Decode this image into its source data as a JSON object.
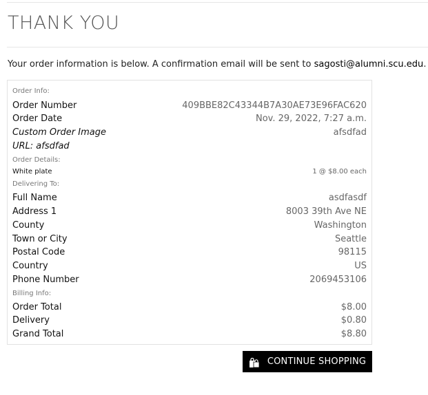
{
  "page": {
    "title": "THANK YOU",
    "intro_text": "Your order information is below. A confirmation email will be sent to",
    "email": "sagosti@alumni.scu.edu",
    "intro_end": "."
  },
  "order_info": {
    "section_label": "Order Info:",
    "order_number_label": "Order Number",
    "order_number_value": "409BBE82C43344B7A30AE73E96FAC620",
    "order_date_label": "Order Date",
    "order_date_value": "Nov. 29, 2022, 7:27 a.m.",
    "custom_image_label": "Custom Order Image",
    "custom_image_value": "afsdfad",
    "url_label": "URL: afsdfad"
  },
  "order_details": {
    "section_label": "Order Details:",
    "item_label": "White plate",
    "item_value": "1 @ $8.00 each"
  },
  "delivering_to": {
    "section_label": "Delivering To:",
    "full_name_label": "Full Name",
    "full_name_value": "asdfasdf",
    "address1_label": "Address 1",
    "address1_value": "8003 39th Ave NE",
    "county_label": "County",
    "county_value": "Washington",
    "town_label": "Town or City",
    "town_value": "Seattle",
    "postal_label": "Postal Code",
    "postal_value": "98115",
    "country_label": "Country",
    "country_value": "US",
    "phone_label": "Phone Number",
    "phone_value": "2069453106"
  },
  "billing_info": {
    "section_label": "Billing Info:",
    "order_total_label": "Order Total",
    "order_total_value": "$8.00",
    "delivery_label": "Delivery",
    "delivery_value": "$0.80",
    "grand_total_label": "Grand Total",
    "grand_total_value": "$8.80"
  },
  "actions": {
    "continue_label": "CONTINUE SHOPPING",
    "continue_icon": "shopping-bags-icon"
  }
}
